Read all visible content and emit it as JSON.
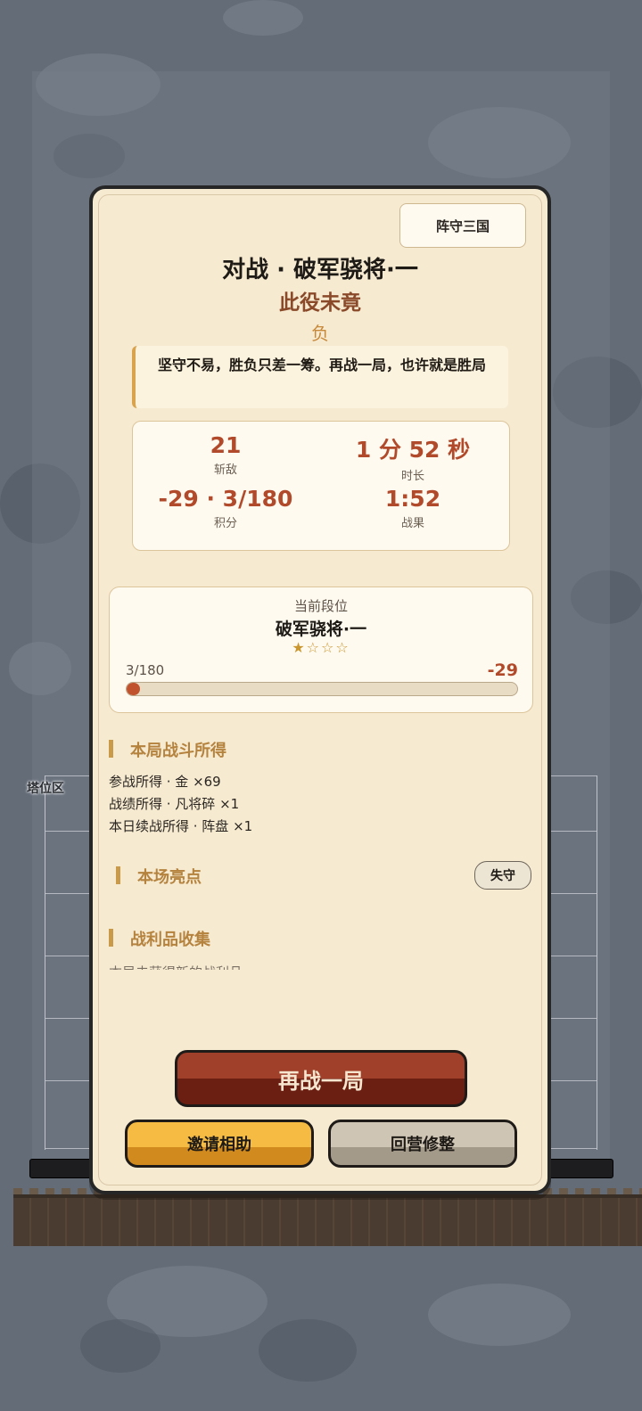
{
  "modal": {
    "tag": "阵守三国",
    "title": "对战 · 破军骁将·一",
    "subtitle": "此役未竟",
    "result": "负",
    "quote": "坚守不易，胜负只差一筹。再战一局，也许就是胜局"
  },
  "stats": [
    {
      "value": "21",
      "label": "斩敌"
    },
    {
      "value": "1 分 52 秒",
      "label": "时长"
    },
    {
      "value": "-29 · 3/180",
      "label": "积分"
    },
    {
      "value": "1:52",
      "label": "战果"
    }
  ],
  "rank": {
    "label": "当前段位",
    "name": "破军骁将·一",
    "stars_text": "★☆☆☆",
    "stars_filled": 1,
    "stars_total": 4,
    "progress_text": "3/180",
    "progress_fraction": 0.017,
    "delta": "-29"
  },
  "sections": {
    "rewards": {
      "title": "本局战斗所得",
      "lines": [
        "参战所得 · 金 ×69",
        "战绩所得 · 凡将碎 ×1",
        "本日续战所得 · 阵盘 ×1"
      ]
    },
    "highlights": {
      "title": "本场亮点",
      "tag": "失守"
    },
    "loot": {
      "title": "战利品收集",
      "faded_line": "本局未获得新的战利品"
    }
  },
  "buttons": {
    "retry": "再战一局",
    "invite": "邀请相助",
    "back": "回营修整"
  },
  "background": {
    "zone_label": "塔位区"
  },
  "colors": {
    "accent": "#b14a2a",
    "gold": "#c89a4a",
    "panel": "#f6ead1"
  }
}
